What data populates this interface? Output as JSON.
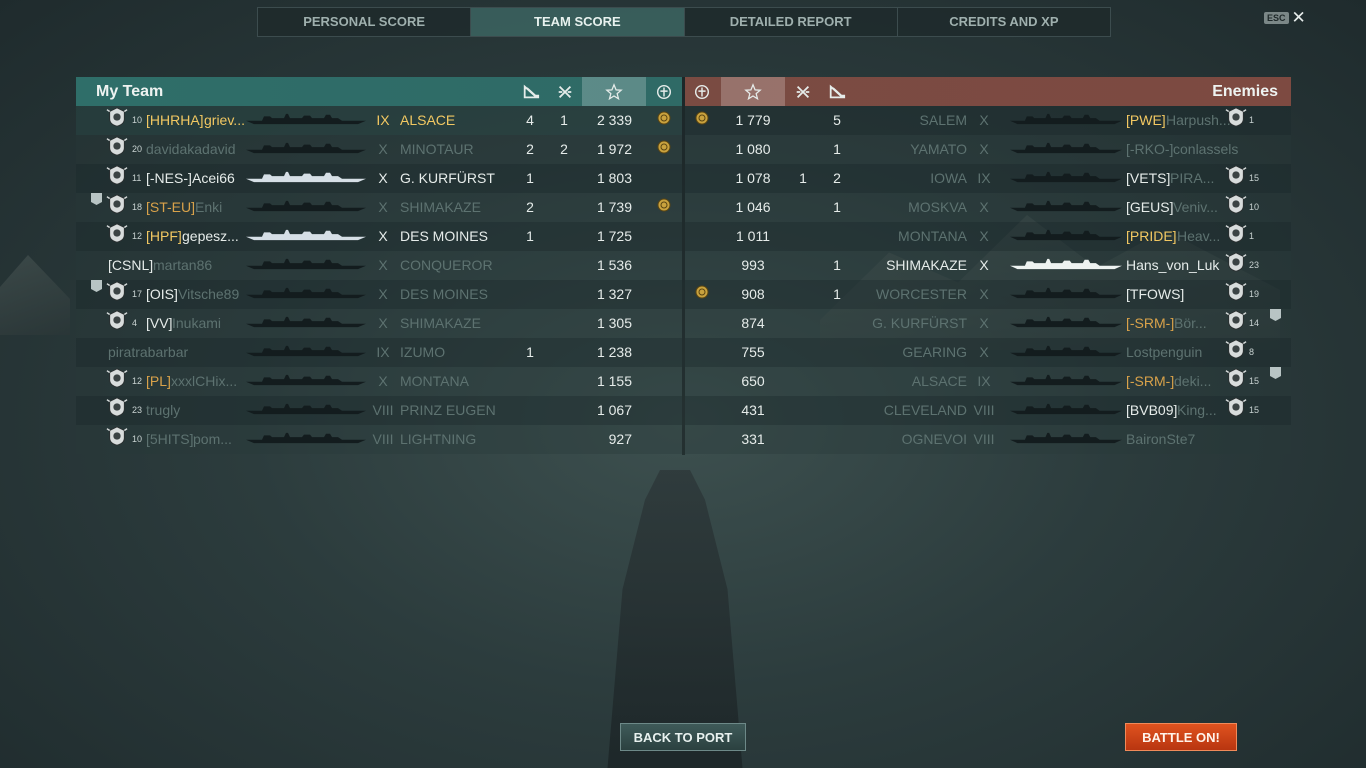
{
  "tabs": [
    {
      "label": "PERSONAL SCORE",
      "active": false
    },
    {
      "label": "TEAM SCORE",
      "active": true
    },
    {
      "label": "DETAILED REPORT",
      "active": false
    },
    {
      "label": "CREDITS AND XP",
      "active": false
    }
  ],
  "esc": {
    "key": "ESC"
  },
  "my_team": {
    "title": "My Team",
    "rows": [
      {
        "level": "10",
        "tag": "[HHRHA]",
        "name": "griev...",
        "tier": "IX",
        "ship": "ALSACE",
        "ribbon_a": "4",
        "ribbon_b": "1",
        "score": "2 339",
        "highlight": true
      },
      {
        "level": "20",
        "tag": "",
        "name": "davidakadavid",
        "tier": "X",
        "ship": "MINOTAUR",
        "ribbon_a": "2",
        "ribbon_b": "2",
        "score": "1 972"
      },
      {
        "level": "11",
        "tag": "[-NES-]",
        "name": "Acei66",
        "tier": "X",
        "ship": "G. KURFÜRST",
        "ribbon_a": "1",
        "ribbon_b": "",
        "score": "1 803"
      },
      {
        "level": "18",
        "tag": "[ST-EU]",
        "name": "Enki",
        "tier": "X",
        "ship": "SHIMAKAZE",
        "ribbon_a": "2",
        "ribbon_b": "",
        "score": "1 739"
      },
      {
        "level": "12",
        "tag": "[HPF]",
        "name": "gepesz...",
        "tier": "X",
        "ship": "DES MOINES",
        "ribbon_a": "1",
        "ribbon_b": "",
        "score": "1 725"
      },
      {
        "level": "",
        "tag": "[CSNL]",
        "name": "martan86",
        "tier": "X",
        "ship": "CONQUEROR",
        "ribbon_a": "",
        "ribbon_b": "",
        "score": "1 536"
      },
      {
        "level": "17",
        "tag": "[OIS]",
        "name": "Vitsche89",
        "tier": "X",
        "ship": "DES MOINES",
        "ribbon_a": "",
        "ribbon_b": "",
        "score": "1 327"
      },
      {
        "level": "4",
        "tag": "[VV]",
        "name": "Inukami",
        "tier": "X",
        "ship": "SHIMAKAZE",
        "ribbon_a": "",
        "ribbon_b": "",
        "score": "1 305"
      },
      {
        "level": "",
        "tag": "",
        "name": "piratrabarbar",
        "tier": "IX",
        "ship": "IZUMO",
        "ribbon_a": "1",
        "ribbon_b": "",
        "score": "1 238"
      },
      {
        "level": "12",
        "tag": "[PL]",
        "name": "xxxlCHix...",
        "tier": "X",
        "ship": "MONTANA",
        "ribbon_a": "",
        "ribbon_b": "",
        "score": "1 155"
      },
      {
        "level": "23",
        "tag": "",
        "name": "trugly",
        "tier": "VIII",
        "ship": "PRINZ EUGEN",
        "ribbon_a": "",
        "ribbon_b": "",
        "score": "1 067"
      },
      {
        "level": "10",
        "tag": "[5HITS]",
        "name": "pom...",
        "tier": "VIII",
        "ship": "LIGHTNING",
        "ribbon_a": "",
        "ribbon_b": "",
        "score": "927"
      }
    ]
  },
  "enemies": {
    "title": "Enemies",
    "rows": [
      {
        "score": "1 779",
        "ribbon_b": "",
        "ribbon_a": "5",
        "ship": "SALEM",
        "tier": "X",
        "tag": "[PWE]",
        "name": "Harpush...",
        "level": "1"
      },
      {
        "score": "1 080",
        "ribbon_b": "",
        "ribbon_a": "1",
        "ship": "YAMATO",
        "tier": "X",
        "tag": "[-RKO-]",
        "name": "conlassels",
        "level": ""
      },
      {
        "score": "1 078",
        "ribbon_b": "1",
        "ribbon_a": "2",
        "ship": "IOWA",
        "tier": "IX",
        "tag": "[VETS]",
        "name": "PIRA...",
        "level": "15"
      },
      {
        "score": "1 046",
        "ribbon_b": "",
        "ribbon_a": "1",
        "ship": "MOSKVA",
        "tier": "X",
        "tag": "[GEUS]",
        "name": "Veniv...",
        "level": "10"
      },
      {
        "score": "1 011",
        "ribbon_b": "",
        "ribbon_a": "",
        "ship": "MONTANA",
        "tier": "X",
        "tag": "[PRIDE]",
        "name": "Heav...",
        "level": "1"
      },
      {
        "score": "993",
        "ribbon_b": "",
        "ribbon_a": "1",
        "ship": "SHIMAKAZE",
        "tier": "X",
        "tag": "",
        "name": "Hans_von_Luk",
        "level": "23"
      },
      {
        "score": "908",
        "ribbon_b": "",
        "ribbon_a": "1",
        "ship": "WORCESTER",
        "tier": "X",
        "tag": "[TFOWS]",
        "name": "",
        "level": "19"
      },
      {
        "score": "874",
        "ribbon_b": "",
        "ribbon_a": "",
        "ship": "G. KURFÜRST",
        "tier": "X",
        "tag": "[-SRM-]",
        "name": "Bör...",
        "level": "14"
      },
      {
        "score": "755",
        "ribbon_b": "",
        "ribbon_a": "",
        "ship": "GEARING",
        "tier": "X",
        "tag": "",
        "name": "Lostpenguin",
        "level": "8"
      },
      {
        "score": "650",
        "ribbon_b": "",
        "ribbon_a": "",
        "ship": "ALSACE",
        "tier": "IX",
        "tag": "[-SRM-]",
        "name": "deki...",
        "level": "15"
      },
      {
        "score": "431",
        "ribbon_b": "",
        "ribbon_a": "",
        "ship": "CLEVELAND",
        "tier": "VIII",
        "tag": "[BVB09]",
        "name": "King...",
        "level": "15"
      },
      {
        "score": "331",
        "ribbon_b": "",
        "ribbon_a": "",
        "ship": "OGNEVOI",
        "tier": "VIII",
        "tag": "",
        "name": "BaironSte7",
        "level": ""
      }
    ]
  },
  "buttons": {
    "back_to_port": "BACK TO PORT",
    "battle_on": "BATTLE ON!"
  },
  "colors": {
    "accent_team": "#2f6e69",
    "accent_enemy": "#7a4b42",
    "highlight_gold": "#f2c862",
    "division_tag": "#d9a24a",
    "battle_button": "#d24a1a"
  }
}
